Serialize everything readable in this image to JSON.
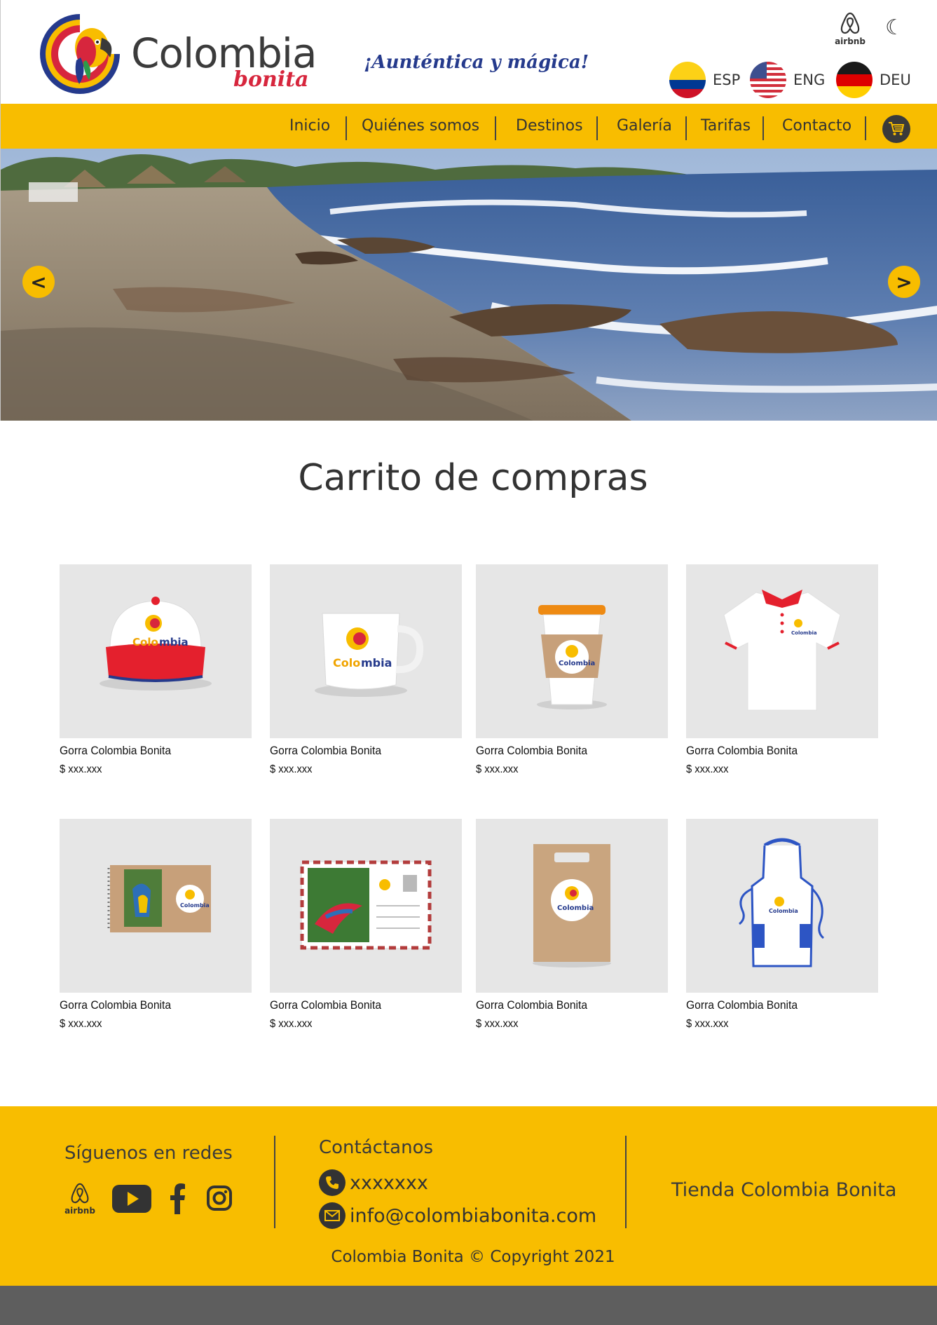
{
  "brand": {
    "name": "Colombia",
    "sub": "bonita",
    "tagline": "¡Aunténtica y mágica!"
  },
  "header": {
    "airbnb_label": "airbnb",
    "languages": [
      {
        "code": "ESP"
      },
      {
        "code": "ENG"
      },
      {
        "code": "DEU"
      }
    ]
  },
  "nav": {
    "items": [
      "Inicio",
      "Quiénes somos",
      "Destinos",
      "Galería",
      "Tarifas",
      "Contacto"
    ]
  },
  "cart": {
    "title": "Carrito de compras",
    "products": [
      {
        "name": "Gorra Colombia Bonita",
        "price": "$ xxx.xxx",
        "image": "cap"
      },
      {
        "name": "Gorra Colombia Bonita",
        "price": "$ xxx.xxx",
        "image": "mug"
      },
      {
        "name": "Gorra Colombia Bonita",
        "price": "$ xxx.xxx",
        "image": "coffee-cup"
      },
      {
        "name": "Gorra Colombia Bonita",
        "price": "$ xxx.xxx",
        "image": "polo-shirt"
      },
      {
        "name": "Gorra Colombia Bonita",
        "price": "$ xxx.xxx",
        "image": "notebook"
      },
      {
        "name": "Gorra Colombia Bonita",
        "price": "$ xxx.xxx",
        "image": "postcard"
      },
      {
        "name": "Gorra Colombia Bonita",
        "price": "$ xxx.xxx",
        "image": "paper-bag"
      },
      {
        "name": "Gorra Colombia Bonita",
        "price": "$ xxx.xxx",
        "image": "apron"
      }
    ]
  },
  "footer": {
    "social_title": "Síguenos en redes",
    "social_airbnb_label": "airbnb",
    "contact_title": "Contáctanos",
    "phone": "xxxxxxx",
    "email": "info@colombiabonita.com",
    "store": "Tienda Colombia Bonita",
    "copyright": "Colombia Bonita © Copyright 2021"
  },
  "colors": {
    "accent": "#f8bd00",
    "dark": "#333333",
    "bottom_bar": "#5e5e5e",
    "tagline": "#253a8c",
    "brand_red": "#d7263d"
  },
  "icons": {
    "hero_prev": "<",
    "hero_next": ">",
    "theme": "☾"
  }
}
